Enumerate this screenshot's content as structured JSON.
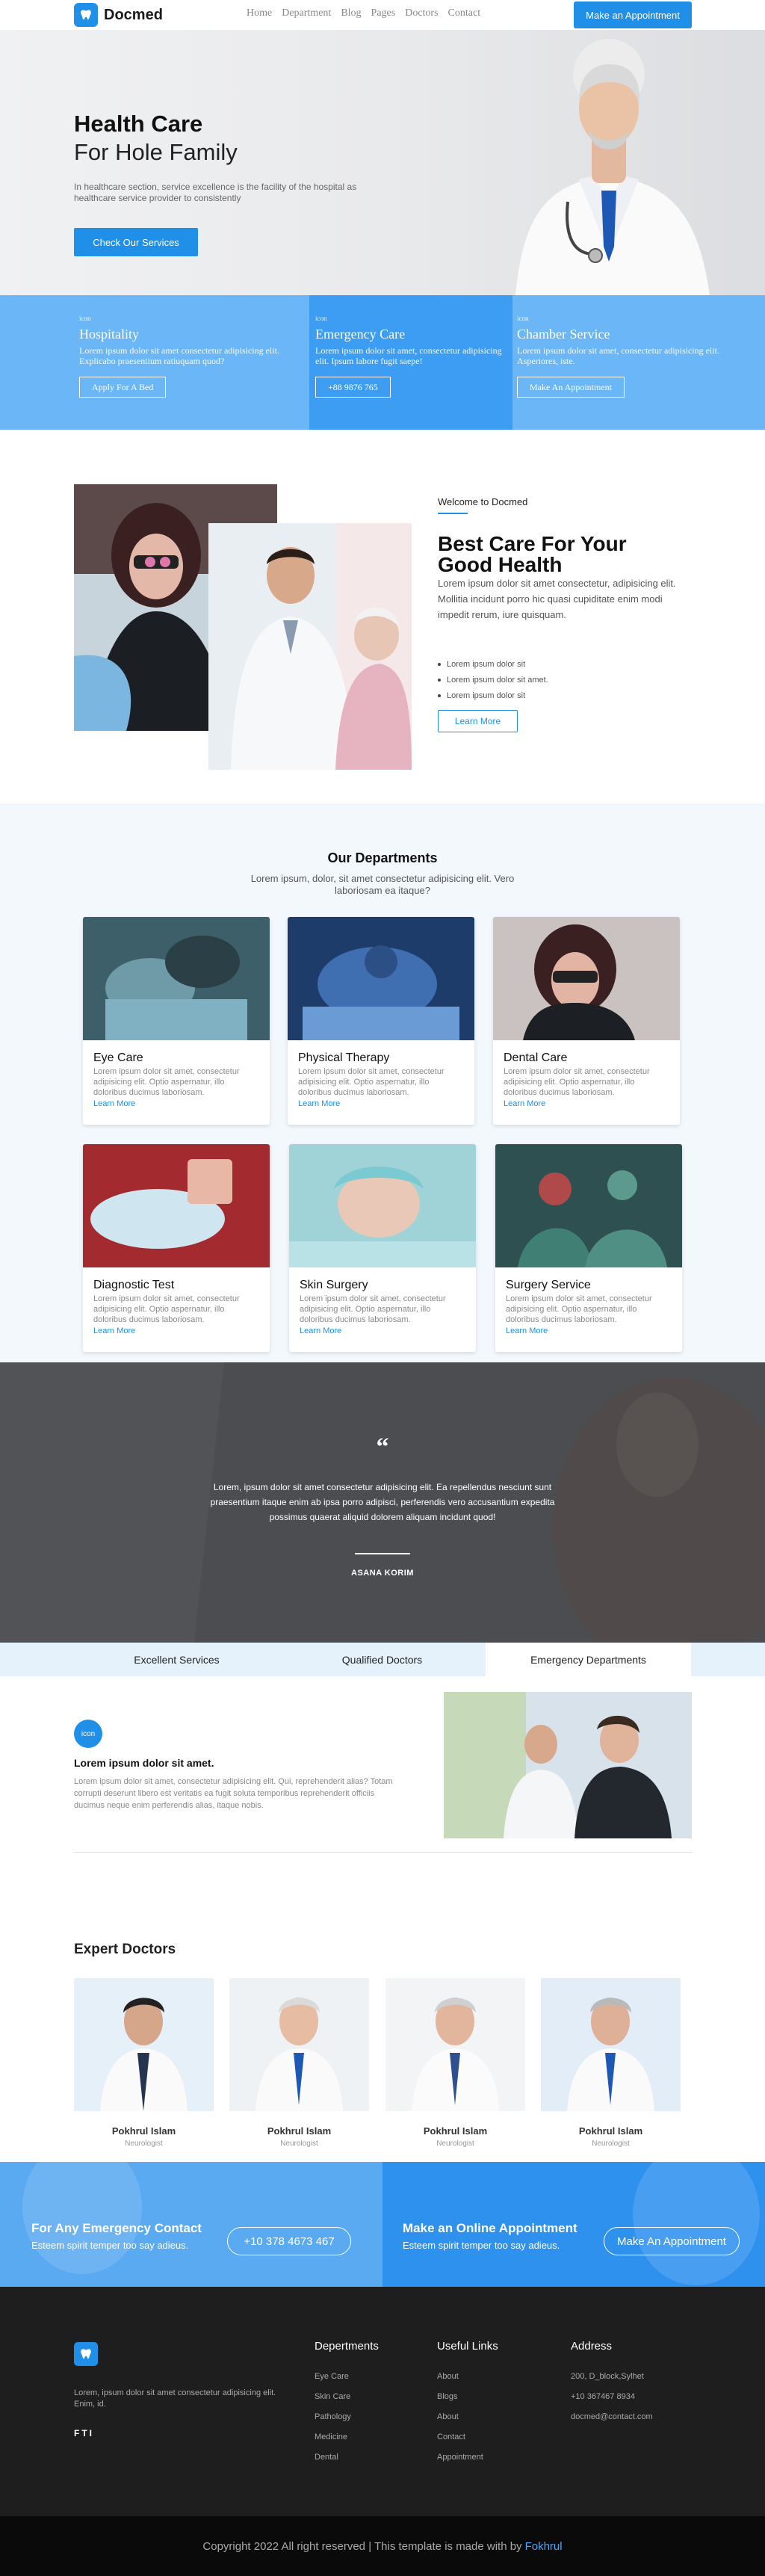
{
  "header": {
    "brand": "Docmed",
    "nav": [
      "Home",
      "Department",
      "Blog",
      "Pages",
      "Doctors",
      "Contact"
    ],
    "appointment_button": "Make an Appointment"
  },
  "hero": {
    "title": "Health Care",
    "subtitle": "For Hole Family",
    "text": "In healthcare section, service excellence is the facility of the hospital as healthcare service provider to consistently",
    "button": "Check Our Services"
  },
  "services": [
    {
      "icon_label": "icon",
      "title": "Hospitality",
      "text": "Lorem ipsum dolor sit amet consectetur adipisicing elit. Explicabo praesentium ratiuquam quod?",
      "button": "Apply For A Bed",
      "color": "#5fb0f6"
    },
    {
      "icon_label": "icon",
      "title": "Emergency Care",
      "text": "Lorem ipsum dolor sit amet, consectetur adipisicing elit. Ipsum labore fugit saepe!",
      "button": "+88 9876 765",
      "color": "#3c9cf0"
    },
    {
      "icon_label": "icon",
      "title": "Chamber Service",
      "text": "Lorem ipsum dolor sit amet, consectetur adipisicing elit. Asperiores, iste.",
      "button": "Make An Appointment",
      "color": "#5fb0f6"
    }
  ],
  "welcome": {
    "subtitle": "Welcome to Docmed",
    "title": "Best Care For Your Good Health",
    "text": "Lorem ipsum dolor sit amet consectetur, adipisicing elit. Mollitia incidunt porro hic quasi cupiditate enim modi impedit rerum, iure quisquam.",
    "list": [
      "Lorem ipsum dolor sit",
      "Lorem ipsum dolor sit amet.",
      "Lorem ipsum dolor sit"
    ],
    "button": "Learn More"
  },
  "departments": {
    "title": "Our Departments",
    "subtitle": "Lorem ipsum, dolor, sit amet consectetur adipisicing elit. Vero laboriosam ea itaque?",
    "cards": [
      {
        "title": "Eye Care",
        "text": "Lorem ipsum dolor sit amet, consectetur adipisicing elit. Optio aspernatur, illo doloribus ducimus laboriosam.",
        "link": "Learn More"
      },
      {
        "title": "Physical Therapy",
        "text": "Lorem ipsum dolor sit amet, consectetur adipisicing elit. Optio aspernatur, illo doloribus ducimus laboriosam.",
        "link": "Learn More"
      },
      {
        "title": "Dental Care",
        "text": "Lorem ipsum dolor sit amet, consectetur adipisicing elit. Optio aspernatur, illo doloribus ducimus laboriosam.",
        "link": "Learn More"
      },
      {
        "title": "Diagnostic Test",
        "text": "Lorem ipsum dolor sit amet, consectetur adipisicing elit. Optio aspernatur, illo doloribus ducimus laboriosam.",
        "link": "Learn More"
      },
      {
        "title": "Skin Surgery",
        "text": "Lorem ipsum dolor sit amet, consectetur adipisicing elit. Optio aspernatur, illo doloribus ducimus laboriosam.",
        "link": "Learn More"
      },
      {
        "title": "Surgery Service",
        "text": "Lorem ipsum dolor sit amet, consectetur adipisicing elit. Optio aspernatur, illo doloribus ducimus laboriosam.",
        "link": "Learn More"
      }
    ]
  },
  "testimonial": {
    "mark": "“",
    "text": "Lorem, ipsum dolor sit amet consectetur adipisicing elit. Ea repellendus nesciunt sunt praesentium itaque enim ab ipsa porro adipisci, perferendis vero accusantium expedita possimus quaerat aliquid dolorem aliquam incidunt quod!",
    "name": "ASANA KORIM"
  },
  "tabs": {
    "items": [
      "Excellent Services",
      "Qualified Doctors",
      "Emergency Departments"
    ],
    "active_index": 2,
    "icon_label": "icon",
    "title": "Lorem ipsum dolor sit amet.",
    "text": "Lorem ipsum dolor sit amet, consectetur adipisicing elit. Qui, reprehenderit alias? Totam corrupti deserunt libero est veritatis ea fugit soluta temporibus reprehenderit officiis ducimus neque enim perferendis alias, itaque nobis."
  },
  "doctors": {
    "title": "Expert Doctors",
    "items": [
      {
        "name": "Pokhrul Islam",
        "role": "Neurologist"
      },
      {
        "name": "Pokhrul Islam",
        "role": "Neurologist"
      },
      {
        "name": "Pokhrul Islam",
        "role": "Neurologist"
      },
      {
        "name": "Pokhrul Islam",
        "role": "Neurologist"
      }
    ]
  },
  "cta": {
    "left": {
      "title": "For Any Emergency Contact",
      "text": "Esteem spirit temper too say adieus.",
      "button": "+10 378 4673 467"
    },
    "right": {
      "title": "Make an Online Appointment",
      "text": "Esteem spirit temper too say adieus.",
      "button": "Make An Appointment"
    }
  },
  "footer": {
    "text": "Lorem, ipsum dolor sit amet consectetur adipisicing elit. Enim, id.",
    "brand": "FTI",
    "columns": [
      {
        "title": "Depertments",
        "items": [
          "Eye Care",
          "Skin Care",
          "Pathology",
          "Medicine",
          "Dental"
        ]
      },
      {
        "title": "Useful Links",
        "items": [
          "About",
          "Blogs",
          "About",
          "Contact",
          "Appointment"
        ]
      },
      {
        "title": "Address",
        "items": [
          "200, D_block,Sylhet",
          "+10 367467 8934",
          "docmed@contact.com"
        ]
      }
    ],
    "copyright": "Copyright 2022 All right reserved | This template is made with by",
    "copyright_author": "Fokhrul"
  },
  "colors": {
    "accent": "#1f8fe8",
    "footer": "#1e1e1e"
  }
}
